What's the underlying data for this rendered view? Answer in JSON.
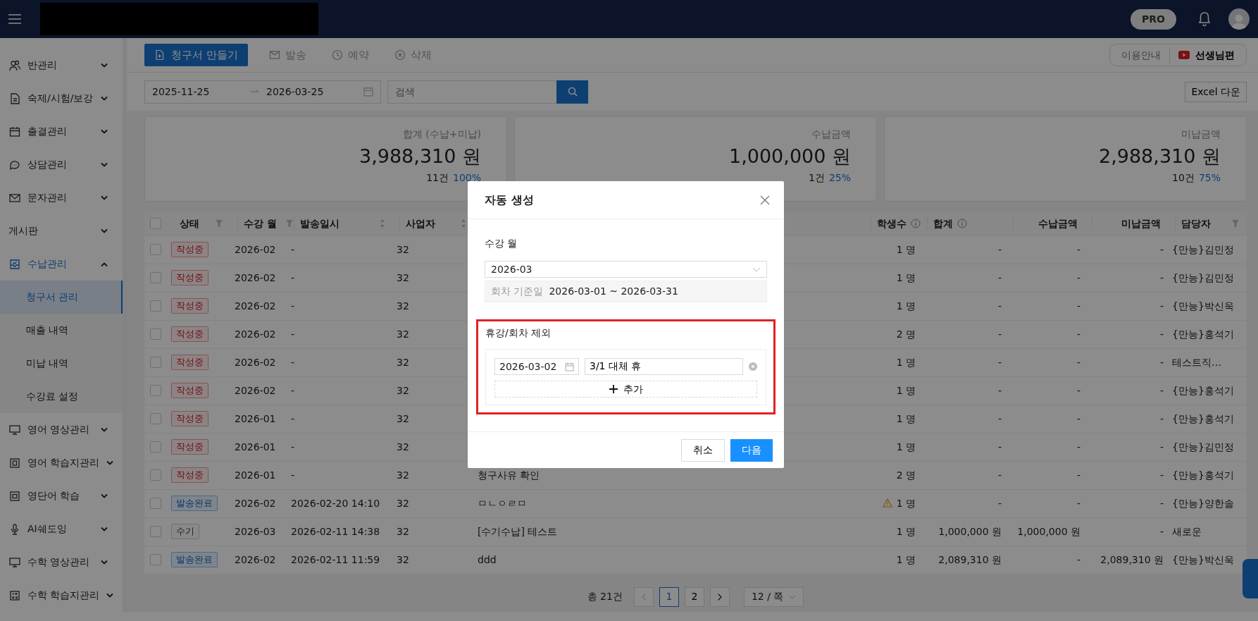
{
  "topbar": {
    "plan_badge": "PRO"
  },
  "sidebar": {
    "items": [
      {
        "label": "반관리",
        "expanded": false,
        "selected": false
      },
      {
        "label": "숙제/시험/보강",
        "expanded": false,
        "selected": false
      },
      {
        "label": "출결관리",
        "expanded": false,
        "selected": false
      },
      {
        "label": "상담관리",
        "expanded": false,
        "selected": false
      },
      {
        "label": "문자관리",
        "expanded": false,
        "selected": false
      },
      {
        "label": "게시판",
        "expanded": false,
        "selected": false
      },
      {
        "label": "수납관리",
        "expanded": true,
        "selected": true,
        "children": [
          {
            "label": "청구서 관리",
            "selected": true
          },
          {
            "label": "매출 내역",
            "selected": false
          },
          {
            "label": "미납 내역",
            "selected": false
          },
          {
            "label": "수강료 설정",
            "selected": false
          }
        ]
      },
      {
        "label": "영어 영상관리",
        "expanded": false,
        "selected": false
      },
      {
        "label": "영어 학습지관리",
        "expanded": false,
        "selected": false
      },
      {
        "label": "영단어 학습",
        "expanded": false,
        "selected": false
      },
      {
        "label": "AI쉐도잉",
        "expanded": false,
        "selected": false
      },
      {
        "label": "수학 영상관리",
        "expanded": false,
        "selected": false
      },
      {
        "label": "수학 학습지관리",
        "expanded": false,
        "selected": false
      }
    ]
  },
  "toolbar": {
    "buttons": [
      {
        "label": "청구서 만들기",
        "kind": "primary",
        "disabled": false
      },
      {
        "label": "발송",
        "kind": "plain",
        "disabled": true
      },
      {
        "label": "예약",
        "kind": "plain",
        "disabled": true
      },
      {
        "label": "삭제",
        "kind": "plain",
        "disabled": true
      }
    ],
    "guide_link": "이용안내",
    "video_button": "선생님편"
  },
  "filters": {
    "date_from": "2025-11-25",
    "date_to": "2026-03-25",
    "search_placeholder": "검색",
    "excel_button": "Excel 다운"
  },
  "summary_cards": [
    {
      "label": "합계 (수납+미납)",
      "amount": "3,988,310 원",
      "count": "11건",
      "percent": "100%"
    },
    {
      "label": "수납금액",
      "amount": "1,000,000 원",
      "count": "1건",
      "percent": "25%"
    },
    {
      "label": "미납금액",
      "amount": "2,988,310 원",
      "count": "10건",
      "percent": "75%"
    }
  ],
  "table": {
    "all_checked": false,
    "columns": [
      "상태",
      "수강 월",
      "발송일시",
      "사업자",
      null,
      "학생수",
      "합계",
      "수납금액",
      "미납금액",
      "담당자"
    ],
    "rows": [
      {
        "checked": false,
        "kind": "draft",
        "warning": false,
        "cells": [
          "작성중",
          "2026-02",
          "-",
          "32",
          null,
          "1 명",
          "-",
          "-",
          "-",
          "{만능}김민정"
        ]
      },
      {
        "checked": false,
        "kind": "draft",
        "warning": false,
        "cells": [
          "작성중",
          "2026-02",
          "-",
          "32",
          null,
          "1 명",
          "-",
          "-",
          "-",
          "{만능}김민정"
        ]
      },
      {
        "checked": false,
        "kind": "draft",
        "warning": false,
        "cells": [
          "작성중",
          "2026-02",
          "-",
          "32",
          null,
          "1 명",
          "-",
          "-",
          "-",
          "{만능}박신욱"
        ]
      },
      {
        "checked": false,
        "kind": "draft",
        "warning": false,
        "cells": [
          "작성중",
          "2026-02",
          "-",
          "32",
          null,
          "2 명",
          "-",
          "-",
          "-",
          "{만능}홍석기"
        ]
      },
      {
        "checked": false,
        "kind": "draft",
        "warning": false,
        "cells": [
          "작성중",
          "2026-02",
          "-",
          "32",
          null,
          "1 명",
          "-",
          "-",
          "-",
          "테스트직…"
        ]
      },
      {
        "checked": false,
        "kind": "draft",
        "warning": false,
        "cells": [
          "작성중",
          "2026-02",
          "-",
          "32",
          null,
          "1 명",
          "-",
          "-",
          "-",
          "{만능}홍석기"
        ]
      },
      {
        "checked": false,
        "kind": "draft",
        "warning": false,
        "cells": [
          "작성중",
          "2026-01",
          "-",
          "32",
          null,
          "1 명",
          "-",
          "-",
          "-",
          "{만능}홍석기"
        ]
      },
      {
        "checked": false,
        "kind": "draft",
        "warning": false,
        "cells": [
          "작성중",
          "2026-01",
          "-",
          "32",
          null,
          "1 명",
          "-",
          "-",
          "-",
          "{만능}김민정"
        ]
      },
      {
        "checked": false,
        "kind": "draft",
        "warning": false,
        "cells": [
          "작성중",
          "2026-01",
          "-",
          "32",
          "청구사유 확인",
          "2 명",
          "-",
          "-",
          "-",
          "{만능}홍석기"
        ]
      },
      {
        "checked": false,
        "kind": "sent",
        "warning": true,
        "cells": [
          "발송완료",
          "2026-02",
          "2026-02-20 14:10",
          "32",
          "ㅁㄴㅇㄹㅁ",
          "1 명",
          "-",
          "-",
          "-",
          "{만능}양한솔"
        ]
      },
      {
        "checked": false,
        "kind": "manual",
        "warning": false,
        "cells": [
          "수기",
          "2026-03",
          "2026-02-11 14:38",
          "32",
          "[수기수납] 테스트",
          "1 명",
          "1,000,000 원",
          "1,000,000 원",
          "-",
          "새로운"
        ]
      },
      {
        "checked": false,
        "kind": "sent",
        "warning": false,
        "cells": [
          "발송완료",
          "2026-02",
          "2026-02-11 11:59",
          "32",
          "ddd",
          "1 명",
          "2,089,310 원",
          "-",
          "2,089,310 원",
          "{만능}박신욱"
        ]
      }
    ]
  },
  "pagination": {
    "total": "총 21건",
    "prev_disabled": true,
    "next_disabled": false,
    "pages": [
      {
        "label": "1",
        "selected": true
      },
      {
        "label": "2",
        "selected": false
      }
    ],
    "page_size": "12 / 쪽"
  },
  "modal": {
    "title": "자동 생성",
    "month_label": "수강 월",
    "month_value": "2026-03",
    "range_label": "회차 기준일",
    "range_value": "2026-03-01 ~ 2026-03-31",
    "highlighted": true,
    "exclude_label": "휴강/회차 제외",
    "exclusions": [
      {
        "date": "2026-03-02",
        "reason": "3/1 대체 휴"
      }
    ],
    "add_button": "추가",
    "cancel_button": "취소",
    "next_button": "다음"
  }
}
